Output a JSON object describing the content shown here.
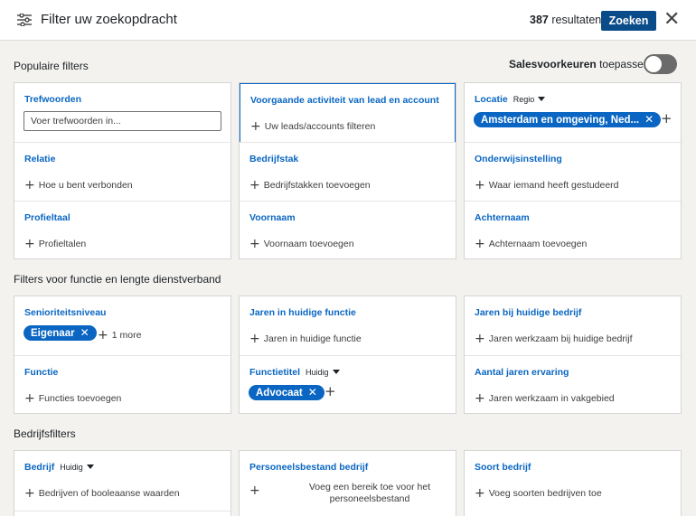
{
  "header": {
    "title": "Filter uw zoekopdracht",
    "result_count": "387",
    "result_label": "resultaten",
    "search_button": "Zoeken",
    "close": "✕"
  },
  "sections": {
    "popular": "Populaire filters",
    "function": "Filters voor functie en lengte dienstverband",
    "company": "Bedrijfsfilters"
  },
  "sales_pref": {
    "bold": "Salesvoorkeuren",
    "rest": "toepassen",
    "enabled": false
  },
  "popular": {
    "keywords": {
      "title": "Trefwoorden",
      "placeholder": "Voer trefwoorden in..."
    },
    "lead_activity": {
      "title": "Voorgaande activiteit van lead en account",
      "sub": "Uw leads/accounts filteren"
    },
    "location": {
      "title": "Locatie",
      "dropdown": "Regio",
      "pill": "Amsterdam en omgeving, Ned...",
      "pill_x": "✕"
    },
    "relation": {
      "title": "Relatie",
      "sub": "Hoe u bent verbonden"
    },
    "industry": {
      "title": "Bedrijfstak",
      "sub": "Bedrijfstakken toevoegen"
    },
    "school": {
      "title": "Onderwijsinstelling",
      "sub": "Waar iemand heeft gestudeerd"
    },
    "language": {
      "title": "Profieltaal",
      "sub": "Profieltalen"
    },
    "firstname": {
      "title": "Voornaam",
      "sub": "Voornaam toevoegen"
    },
    "lastname": {
      "title": "Achternaam",
      "sub": "Achternaam toevoegen"
    }
  },
  "function": {
    "seniority": {
      "title": "Senioriteitsniveau",
      "pill": "Eigenaar",
      "pill_x": "✕",
      "more": "1 more"
    },
    "years_role": {
      "title": "Jaren in huidige functie",
      "sub": "Jaren in huidige functie"
    },
    "years_company": {
      "title": "Jaren bij huidige bedrijf",
      "sub": "Jaren werkzaam bij huidige bedrijf"
    },
    "func": {
      "title": "Functie",
      "sub": "Functies toevoegen"
    },
    "job_title": {
      "title": "Functietitel",
      "dropdown": "Huidig",
      "pill": "Advocaat",
      "pill_x": "✕"
    },
    "experience": {
      "title": "Aantal jaren ervaring",
      "sub": "Jaren werkzaam in vakgebied"
    }
  },
  "company": {
    "company": {
      "title": "Bedrijf",
      "dropdown": "Huidig",
      "sub": "Bedrijven of booleaanse waarden"
    },
    "headcount": {
      "title": "Personeelsbestand bedrijf",
      "sub": "Voeg een bereik toe voor het personeelsbestand"
    },
    "type": {
      "title": "Soort bedrijf",
      "sub": "Voeg soorten bedrijven toe"
    }
  },
  "icons": {
    "filter": "sliders-icon",
    "close": "close-icon",
    "plus": "plus-icon",
    "caret": "caret-down-icon"
  },
  "colors": {
    "accent": "#0a66c2",
    "button": "#0a4c8a",
    "background": "#f3f2ef"
  }
}
